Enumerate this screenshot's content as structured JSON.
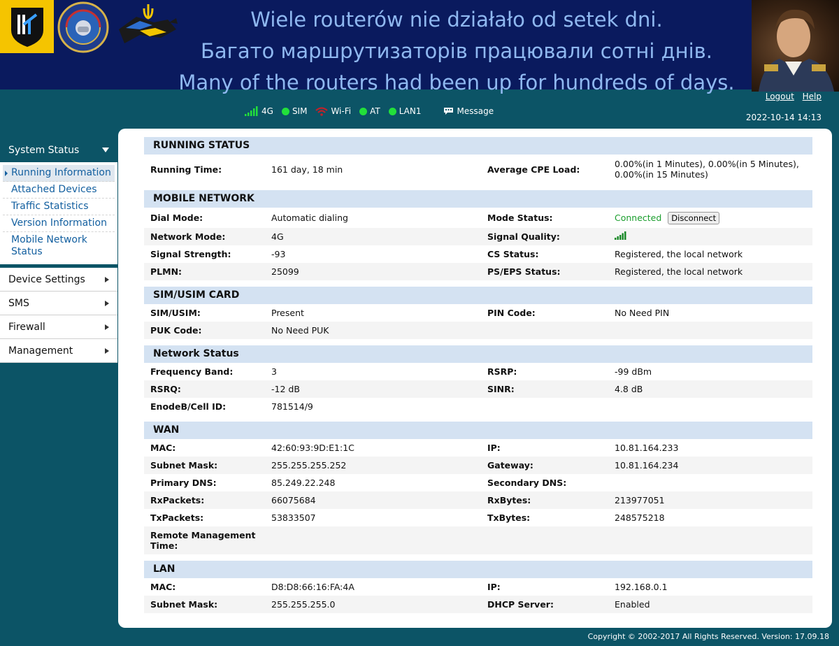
{
  "banner": {
    "line_pl": "Wiele routerów nie działało od setek dni.",
    "line_uk": "Багато маршрутизаторів працювали сотні днів.",
    "line_en": "Many of the routers had been up for hundreds of days."
  },
  "header": {
    "logout": "Logout",
    "help": "Help",
    "datetime": "2022-10-14 14:13",
    "indicators": {
      "net": "4G",
      "sim": "SIM",
      "wifi": "Wi-Fi",
      "at": "AT",
      "lan1": "LAN1",
      "message": "Message"
    }
  },
  "sidebar": {
    "head": "System Status",
    "sub": [
      "Running Information",
      "Attached Devices",
      "Traffic Statistics",
      "Version Information",
      "Mobile Network Status"
    ],
    "menu": [
      "Device Settings",
      "SMS",
      "Firewall",
      "Management"
    ]
  },
  "sections": {
    "running": {
      "title": "RUNNING STATUS",
      "running_time_l": "Running Time:",
      "running_time_v": "161 day, 18 min",
      "cpe_l": "Average CPE Load:",
      "cpe_v": "0.00%(in 1 Minutes), 0.00%(in 5 Minutes), 0.00%(in 15 Minutes)"
    },
    "mobile": {
      "title": "MOBILE NETWORK",
      "dial_l": "Dial Mode:",
      "dial_v": "Automatic dialing",
      "mode_l": "Mode Status:",
      "mode_v": "Connected",
      "disconnect": "Disconnect",
      "netmode_l": "Network Mode:",
      "netmode_v": "4G",
      "quality_l": "Signal Quality:",
      "strength_l": "Signal Strength:",
      "strength_v": "-93",
      "cs_l": "CS Status:",
      "cs_v": "Registered, the local network",
      "plmn_l": "PLMN:",
      "plmn_v": "25099",
      "ps_l": "PS/EPS Status:",
      "ps_v": "Registered, the local network"
    },
    "sim": {
      "title": "SIM/USIM CARD",
      "sim_l": "SIM/USIM:",
      "sim_v": "Present",
      "pin_l": "PIN Code:",
      "pin_v": "No Need PIN",
      "puk_l": "PUK Code:",
      "puk_v": "No Need PUK"
    },
    "netstatus": {
      "title": "Network Status",
      "band_l": "Frequency Band:",
      "band_v": "3",
      "rsrp_l": "RSRP:",
      "rsrp_v": "-99 dBm",
      "rsrq_l": "RSRQ:",
      "rsrq_v": "-12 dB",
      "sinr_l": "SINR:",
      "sinr_v": "4.8 dB",
      "cell_l": "EnodeB/Cell ID:",
      "cell_v": "781514/9"
    },
    "wan": {
      "title": "WAN",
      "mac_l": "MAC:",
      "mac_v": "42:60:93:9D:E1:1C",
      "ip_l": "IP:",
      "ip_v": "10.81.164.233",
      "mask_l": "Subnet Mask:",
      "mask_v": "255.255.255.252",
      "gw_l": "Gateway:",
      "gw_v": "10.81.164.234",
      "pdns_l": "Primary DNS:",
      "pdns_v": "85.249.22.248",
      "sdns_l": "Secondary DNS:",
      "sdns_v": "",
      "rxp_l": "RxPackets:",
      "rxp_v": "66075684",
      "rxb_l": "RxBytes:",
      "rxb_v": "213977051",
      "txp_l": "TxPackets:",
      "txp_v": "53833507",
      "txb_l": "TxBytes:",
      "txb_v": "248575218",
      "rmt_l": "Remote Management Time:"
    },
    "lan": {
      "title": "LAN",
      "mac_l": "MAC:",
      "mac_v": "D8:D8:66:16:FA:4A",
      "ip_l": "IP:",
      "ip_v": "192.168.0.1",
      "mask_l": "Subnet Mask:",
      "mask_v": "255.255.255.0",
      "dhcp_l": "DHCP Server:",
      "dhcp_v": "Enabled"
    }
  },
  "footer": "Copyright © 2002-2017 All Rights Reserved. Version: 17.09.18",
  "colors": {
    "banner_bg": "#0a1a5e",
    "banner_text": "#8fb8f0",
    "page_bg": "#0c5466",
    "section_header": "#d4e2f2",
    "status_green": "#22e03a",
    "wifi_red": "#c0222a",
    "connected": "#1b9e2e",
    "link": "#1460a0"
  },
  "icons": [
    "team-onefist-logo",
    "badge-logo",
    "trident-cat-logo",
    "portrait-image",
    "signal-bars-icon",
    "wifi-icon",
    "message-icon",
    "chevron-down-icon",
    "chevron-right-icon"
  ]
}
